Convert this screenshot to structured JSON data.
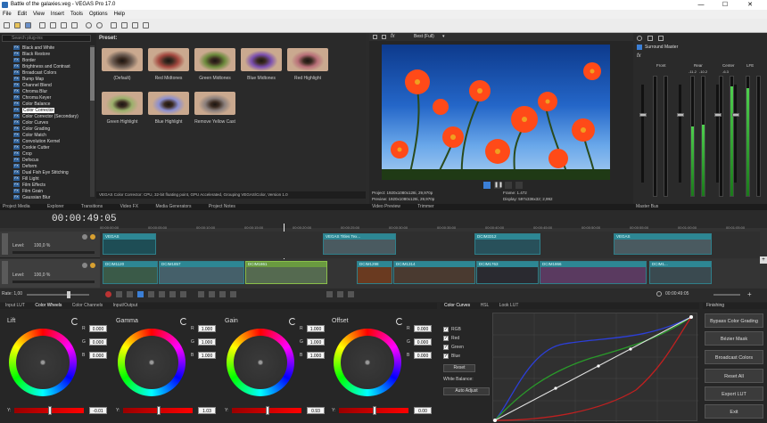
{
  "app": {
    "window_title": "Battle of the galaxies.veg - VEGAS Pro 17.0",
    "window_controls": [
      "—",
      "☐",
      "✕"
    ]
  },
  "menu": [
    "File",
    "Edit",
    "View",
    "Insert",
    "Tools",
    "Options",
    "Help"
  ],
  "fx_browser": {
    "search_placeholder": "Search plug-ins",
    "items": [
      "Black and White",
      "Black Restore",
      "Border",
      "Brightness and Contrast",
      "Broadcast Colors",
      "Bump Map",
      "Channel Blend",
      "Chroma Blur",
      "Chroma Keyer",
      "Color Balance",
      "Color Corrector",
      "Color Corrector (Secondary)",
      "Color Curves",
      "Color Grading",
      "Color Match",
      "Convolution Kernel",
      "Cookie Cutter",
      "Crop",
      "Defocus",
      "Deform",
      "Dual Fish Eye Stitching",
      "Fill Light",
      "Film Effects",
      "Film Grain",
      "Gaussian Blur"
    ],
    "selected": "Color Corrector",
    "fx_badge": "FX"
  },
  "presets": {
    "label": "Preset:",
    "items": [
      {
        "label": "(Default)",
        "tint": "#6f5f55"
      },
      {
        "label": "Red Midtones",
        "tint": "#a3483f"
      },
      {
        "label": "Green Midtones",
        "tint": "#6c8a3c"
      },
      {
        "label": "Blue Midtones",
        "tint": "#7b4fb0"
      },
      {
        "label": "Red Highlight",
        "tint": "#b86f78"
      },
      {
        "label": "Green Highlight",
        "tint": "#9bb06b"
      },
      {
        "label": "Blue Highlight",
        "tint": "#8c8fd0"
      },
      {
        "label": "Remove Yellow Cast",
        "tint": "#8a7f7c"
      }
    ],
    "status": "VEGAS Color Corrector: CPU, 32-bit floating point, GPU Accelerated, Grouping VEGAS\\Color, Version 1.0"
  },
  "tabs_left": [
    "Project Media",
    "Explorer",
    "Transitions",
    "Video FX",
    "Media Generators",
    "Project Notes"
  ],
  "preview": {
    "quality": "Best (Full)",
    "project": "Project:   1920x1080x128i, 29,970p",
    "preview": "Preview:   1920x1080x128i, 29,970p",
    "frame": "Frame:      1.472",
    "display": "Display:    597x336x32; 2,992",
    "tabs": [
      "Video Preview",
      "Trimmer"
    ]
  },
  "mixer": {
    "title": "Surround Master",
    "channels": [
      "Front",
      "Rear",
      "Center",
      "LFE"
    ],
    "peaks": [
      "-11.2",
      "-10.2",
      "-6.3"
    ],
    "levels": [
      0.0,
      0.0,
      0.58,
      0.6,
      0.0,
      0.92,
      0.9,
      0.0
    ],
    "tab": "Master Bus"
  },
  "timeline": {
    "timecode": "00:00:49:05",
    "track1": {
      "level_label": "Level:",
      "level": "100,0 %"
    },
    "track2": {
      "level_label": "Level:",
      "level": "100,0 %"
    },
    "rate": "Rate: 1,00",
    "end_time": "00:00:49:05",
    "ruler": [
      "00:00:00:00",
      "00:00:05:00",
      "00:00:10:00",
      "00:00:15:00",
      "00:00:20:00",
      "00:00:25:00",
      "00:00:30:00",
      "00:00:35:00",
      "00:00:40:00",
      "00:00:45:00",
      "00:00:50:00",
      "00:00:55:00",
      "00:01:00:00",
      "00:01:05:00"
    ],
    "video_clips_top": [
      "VEGAS",
      "VEGAS Titles Tex...",
      "DCIM3312",
      "VEGAS"
    ],
    "video_clips_bottom": [
      "DCIM1120",
      "DCIM1857",
      "DCIM1861",
      "DCIM1298",
      "DCIM1314",
      "DCIM1763",
      "DCIM1866",
      "DCIM1..."
    ]
  },
  "color_grading": {
    "tabs": [
      "Input LUT",
      "Color Wheels",
      "Color Channels",
      "Input/Output"
    ],
    "wheels": [
      {
        "title": "Lift",
        "R": "0.000",
        "G": "0.000",
        "B": "0.000",
        "Y": "-0.01"
      },
      {
        "title": "Gamma",
        "R": "1.000",
        "G": "1.000",
        "B": "1.000",
        "Y": "1.03"
      },
      {
        "title": "Gain",
        "R": "1.000",
        "G": "1.000",
        "B": "1.000",
        "Y": "0.93"
      },
      {
        "title": "Offset",
        "R": "0.000",
        "G": "0.000",
        "B": "0.000",
        "Y": "0.00"
      }
    ],
    "curves_tabs": [
      "Color Curves",
      "HSL",
      "Look LUT"
    ],
    "channels": [
      "RGB",
      "Red",
      "Green",
      "Blue"
    ],
    "reset_label": "Reset",
    "white_balance_label": "White Balance:",
    "auto_adjust_label": "Auto Adjust",
    "finishing_label": "Finishing",
    "finishing_buttons": [
      "Bypass Color Grading",
      "Bézier Mask",
      "Broadcast Colors",
      "Reset All",
      "Export LUT",
      "Exit"
    ]
  }
}
